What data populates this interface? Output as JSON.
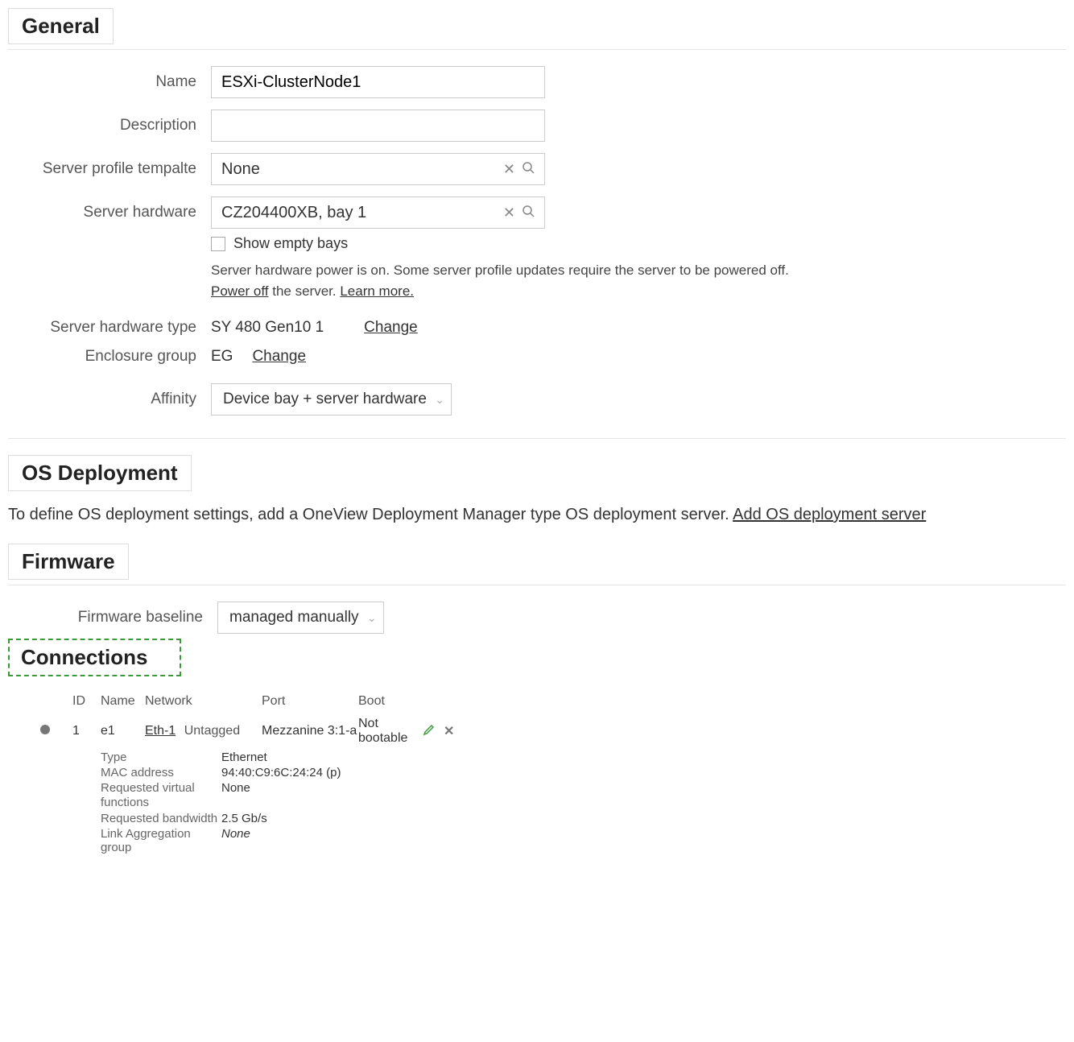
{
  "sections": {
    "general": "General",
    "os": "OS Deployment",
    "firmware": "Firmware",
    "connections": "Connections"
  },
  "general": {
    "name_label": "Name",
    "name_value": "ESXi-ClusterNode1",
    "desc_label": "Description",
    "desc_value": "",
    "tpl_label": "Server profile tempalte",
    "tpl_value": "None",
    "hw_label": "Server hardware",
    "hw_value": "CZ204400XB, bay 1",
    "show_empty": "Show empty bays",
    "power_note_pre": "Server hardware power is on. Some server profile updates require the server to be powered off. ",
    "power_off": "Power off",
    "power_note_mid": " the server. ",
    "learn_more": "Learn more.",
    "hwtype_label": "Server hardware type",
    "hwtype_value": "SY 480 Gen10 1",
    "change": "Change",
    "eg_label": "Enclosure group",
    "eg_value": "EG",
    "aff_label": "Affinity",
    "aff_value": "Device bay + server hardware"
  },
  "os": {
    "text_pre": "To define OS deployment settings, add a OneView Deployment Manager type OS deployment server. ",
    "link": "Add OS deployment server"
  },
  "firmware": {
    "baseline_label": "Firmware baseline",
    "baseline_value": "managed manually"
  },
  "connections": {
    "head": {
      "id": "ID",
      "name": "Name",
      "network": "Network",
      "port": "Port",
      "boot": "Boot"
    },
    "rows": [
      {
        "id": "1",
        "name": "e1",
        "network": "Eth-1",
        "network_tag": "Untagged",
        "port": "Mezzanine 3:1-a",
        "boot": "Not bootable",
        "details": {
          "type_l": "Type",
          "type_v": "Ethernet",
          "mac_l": "MAC address",
          "mac_v": "94:40:C9:6C:24:24",
          "mac_sfx": "(p)",
          "rvf_l": "Requested virtual functions",
          "rvf_v": "None",
          "bw_l": "Requested bandwidth",
          "bw_v": "2.5 Gb/s",
          "lag_l": "Link Aggregation group",
          "lag_v": "None"
        }
      }
    ]
  }
}
